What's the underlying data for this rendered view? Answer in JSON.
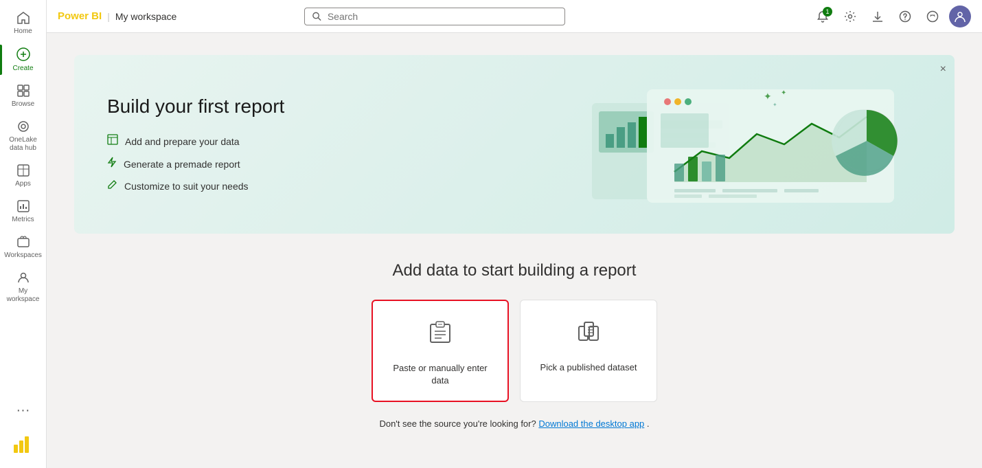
{
  "app": {
    "brand": "Power BI",
    "workspace": "My workspace"
  },
  "header": {
    "search_placeholder": "Search",
    "notification_count": "1"
  },
  "sidebar": {
    "items": [
      {
        "id": "home",
        "label": "Home",
        "icon": "⌂"
      },
      {
        "id": "create",
        "label": "Create",
        "icon": "⊕",
        "active": true
      },
      {
        "id": "browse",
        "label": "Browse",
        "icon": "▦"
      },
      {
        "id": "onelake",
        "label": "OneLake data hub",
        "icon": "◉"
      },
      {
        "id": "apps",
        "label": "Apps",
        "icon": "⊞"
      },
      {
        "id": "metrics",
        "label": "Metrics",
        "icon": "⊟"
      },
      {
        "id": "workspaces",
        "label": "Workspaces",
        "icon": "⊡"
      },
      {
        "id": "myworkspace",
        "label": "My workspace",
        "icon": "👤"
      }
    ],
    "more_label": "···"
  },
  "hero": {
    "title": "Build your first report",
    "features": [
      {
        "icon": "☰",
        "text": "Add and prepare your data"
      },
      {
        "icon": "⚡",
        "text": "Generate a premade report"
      },
      {
        "icon": "🖉",
        "text": "Customize to suit your needs"
      }
    ],
    "close_label": "×"
  },
  "add_data": {
    "title": "Add data to start building a report",
    "cards": [
      {
        "id": "paste",
        "icon": "⊞",
        "label": "Paste or manually enter data",
        "selected": true
      },
      {
        "id": "published",
        "icon": "📊",
        "label": "Pick a published dataset",
        "selected": false
      }
    ],
    "source_text": "Don't see the source you're looking for?",
    "download_link": "Download the desktop app",
    "source_suffix": "."
  }
}
